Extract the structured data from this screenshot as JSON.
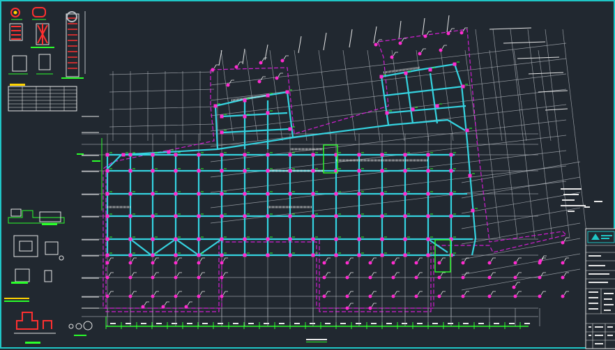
{
  "app": {
    "viewport_name": "cad-model-space",
    "background": "#212830",
    "frame_color": "#1fc6c6"
  },
  "colors": {
    "grid": "#b9bec4",
    "beam": "#35d3e0",
    "column": "#ff2bd0",
    "outline": "#d21fd2",
    "dim": "#2bff2b",
    "wall": "#e8e8e8",
    "detail_red": "#ff3030",
    "detail_yellow": "#ffd400"
  },
  "icons": {
    "north_arrow": "north-arrow-icon",
    "logo": "company-logo-icon"
  }
}
